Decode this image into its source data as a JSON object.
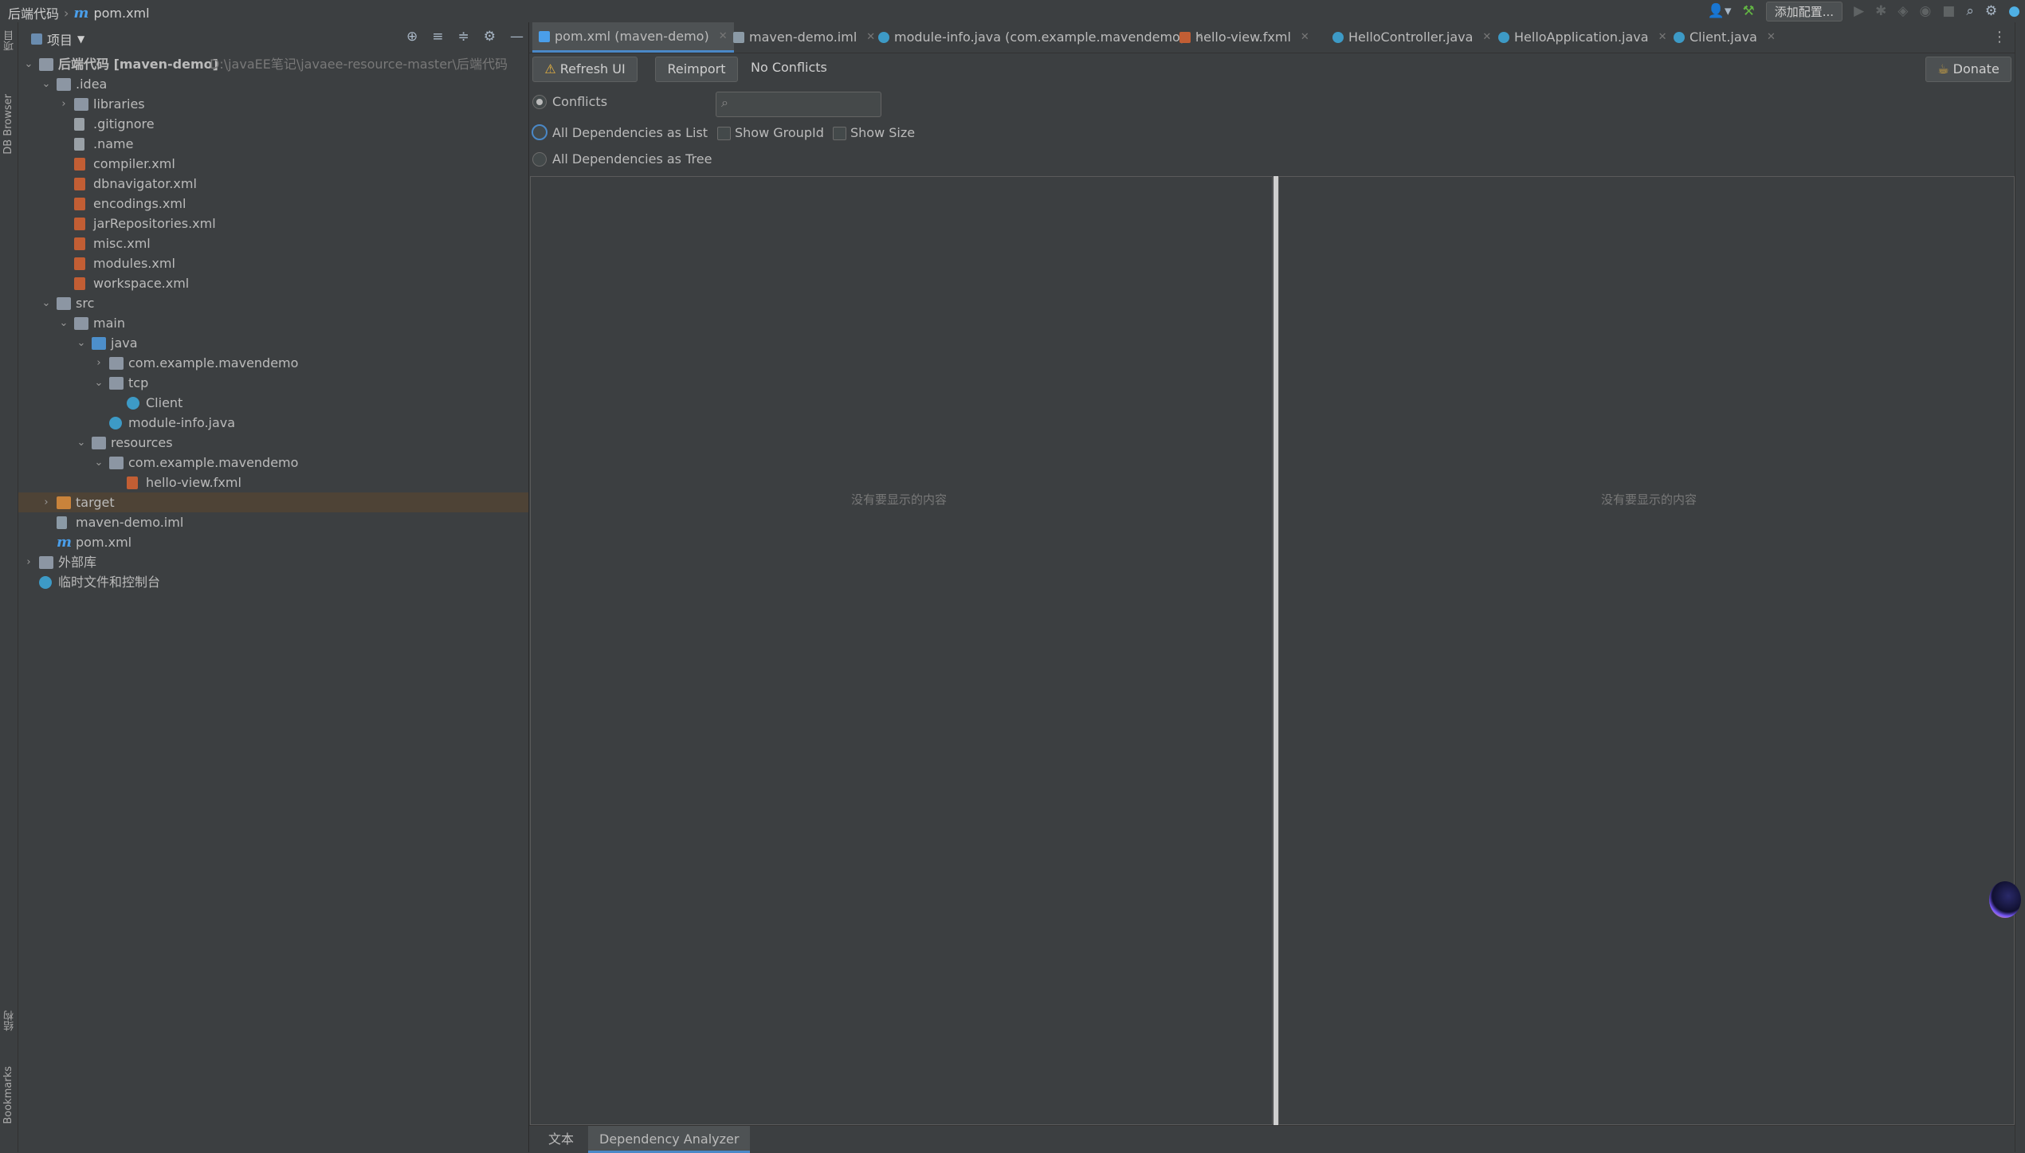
{
  "breadcrumb": {
    "project": "后端代码",
    "file": "pom.xml"
  },
  "toolbar": {
    "add_config": "添加配置..."
  },
  "left_strip": {
    "project": "项目",
    "db_browser": "DB Browser",
    "structure": "结构",
    "bookmarks": "Bookmarks"
  },
  "project_panel": {
    "title": "项目",
    "tree": [
      {
        "label": "后端代码 [maven-demo]",
        "hint": "D:\\javaEE笔记\\javaee-resource-master\\后端代码",
        "depth": 0,
        "arrow": "open",
        "icon": "module-folder"
      },
      {
        "label": ".idea",
        "depth": 1,
        "arrow": "open",
        "icon": "folder"
      },
      {
        "label": "libraries",
        "depth": 2,
        "arrow": "closed",
        "icon": "folder"
      },
      {
        "label": ".gitignore",
        "depth": 2,
        "arrow": "",
        "icon": "file-generic"
      },
      {
        "label": ".name",
        "depth": 2,
        "arrow": "",
        "icon": "file-generic"
      },
      {
        "label": "compiler.xml",
        "depth": 2,
        "arrow": "",
        "icon": "file-xml"
      },
      {
        "label": "dbnavigator.xml",
        "depth": 2,
        "arrow": "",
        "icon": "file-xml"
      },
      {
        "label": "encodings.xml",
        "depth": 2,
        "arrow": "",
        "icon": "file-xml"
      },
      {
        "label": "jarRepositories.xml",
        "depth": 2,
        "arrow": "",
        "icon": "file-xml"
      },
      {
        "label": "misc.xml",
        "depth": 2,
        "arrow": "",
        "icon": "file-xml"
      },
      {
        "label": "modules.xml",
        "depth": 2,
        "arrow": "",
        "icon": "file-xml"
      },
      {
        "label": "workspace.xml",
        "depth": 2,
        "arrow": "",
        "icon": "file-xml"
      },
      {
        "label": "src",
        "depth": 1,
        "arrow": "open",
        "icon": "folder"
      },
      {
        "label": "main",
        "depth": 2,
        "arrow": "open",
        "icon": "folder"
      },
      {
        "label": "java",
        "depth": 3,
        "arrow": "open",
        "icon": "folder-blue"
      },
      {
        "label": "com.example.mavendemo",
        "depth": 4,
        "arrow": "closed",
        "icon": "package"
      },
      {
        "label": "tcp",
        "depth": 4,
        "arrow": "open",
        "icon": "package"
      },
      {
        "label": "Client",
        "depth": 5,
        "arrow": "",
        "icon": "file-java"
      },
      {
        "label": "module-info.java",
        "depth": 4,
        "arrow": "",
        "icon": "file-module"
      },
      {
        "label": "resources",
        "depth": 3,
        "arrow": "open",
        "icon": "folder-res"
      },
      {
        "label": "com.example.mavendemo",
        "depth": 4,
        "arrow": "open",
        "icon": "package"
      },
      {
        "label": "hello-view.fxml",
        "depth": 5,
        "arrow": "",
        "icon": "file-xml"
      },
      {
        "label": "target",
        "depth": 1,
        "arrow": "closed",
        "icon": "folder-orange",
        "selected": true
      },
      {
        "label": "maven-demo.iml",
        "depth": 1,
        "arrow": "",
        "icon": "file-iml"
      },
      {
        "label": "pom.xml",
        "depth": 1,
        "arrow": "",
        "icon": "maven"
      },
      {
        "label": "外部库",
        "depth": 0,
        "arrow": "closed",
        "icon": "library"
      },
      {
        "label": "临时文件和控制台",
        "depth": 0,
        "arrow": "",
        "icon": "scratch"
      }
    ]
  },
  "tabs": [
    {
      "label": "pom.xml (maven-demo)",
      "icon": "maven",
      "active": true
    },
    {
      "label": "maven-demo.iml",
      "icon": "file-iml"
    },
    {
      "label": "module-info.java (com.example.mavendemo)",
      "icon": "file-module"
    },
    {
      "label": "hello-view.fxml",
      "icon": "file-xml"
    },
    {
      "label": "HelloController.java",
      "icon": "file-java"
    },
    {
      "label": "HelloApplication.java",
      "icon": "file-java"
    },
    {
      "label": "Client.java",
      "icon": "file-java"
    }
  ],
  "analyzer": {
    "refresh_label": "Refresh UI",
    "reimport_label": "Reimport",
    "status": "No Conflicts",
    "donate_label": "Donate",
    "options": {
      "conflicts": "Conflicts",
      "as_list": "All Dependencies as List",
      "as_tree": "All Dependencies as Tree",
      "show_group_id": "Show GroupId",
      "show_size": "Show Size"
    },
    "empty_left": "没有要显示的内容",
    "empty_right": "没有要显示的内容"
  },
  "bottom_tabs": {
    "text": "文本",
    "analyzer": "Dependency Analyzer"
  },
  "colors": {
    "accent": "#4a88c7",
    "selection": "#4e4336",
    "background": "#3c3f41"
  }
}
